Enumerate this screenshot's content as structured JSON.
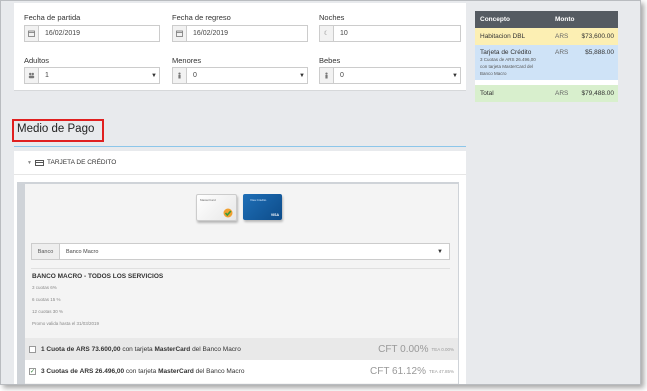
{
  "search_form": {
    "departure_label": "Fecha de partida",
    "departure_value": "16/02/2019",
    "return_label": "Fecha de regreso",
    "return_value": "16/02/2019",
    "nights_label": "Noches",
    "nights_value": "10",
    "adults_label": "Adultos",
    "adults_value": "1",
    "minors_label": "Menores",
    "minors_value": "0",
    "babies_label": "Bebes",
    "babies_value": "0"
  },
  "summary": {
    "col_concept": "Concepto",
    "col_amount": "Monto",
    "rows": [
      {
        "concept": "Habitacion DBL",
        "currency": "ARS",
        "amount": "$73,600.00"
      },
      {
        "concept": "Tarjeta de Crédito",
        "sub1": "3 Cuotas de ARS 26.496,00",
        "sub2": "con tarjeta MasterCard del",
        "sub3": "Banco Macro",
        "currency": "ARS",
        "amount": "$5,888.00"
      }
    ],
    "total": {
      "concept": "Total",
      "currency": "ARS",
      "amount": "$79,488.00"
    }
  },
  "payment": {
    "section_title": "Medio de Pago",
    "method_header": "TARJETA DE CRÉDITO",
    "card1_text": "MasterCard",
    "card2_text": "Visa Crédito",
    "card2_brand": "VISA",
    "bank_label": "Banco",
    "bank_value": "Banco Macro",
    "promo_title": "BANCO MACRO - TODOS LOS SERVICIOS",
    "promo_lines": [
      "3 cuotas 6%",
      "6 cuotas 15 %",
      "12 cuotas 30 %",
      "Promo valida hasta el 31/03/2019"
    ],
    "options": [
      {
        "checked": false,
        "prefix": "1 Cuota de",
        "amount": "ARS 73.600,00",
        "suffix": "con tarjeta",
        "brand": "MasterCard",
        "bank": "del Banco Macro",
        "cft": "CFT 0.00%",
        "tea": "TEA 0.00%"
      },
      {
        "checked": true,
        "prefix": "3 Cuotas de",
        "amount": "ARS 26.496,00",
        "suffix": "con tarjeta",
        "brand": "MasterCard",
        "bank": "del Banco Macro",
        "cft": "CFT 61.12%",
        "tea": "TEA 47.85%"
      }
    ]
  },
  "colors": {
    "summary_header": "#555b62",
    "row_room": "#fcefb3",
    "row_card": "#cfe3f7",
    "row_total": "#d8efcd",
    "highlight_box": "#e02020"
  }
}
